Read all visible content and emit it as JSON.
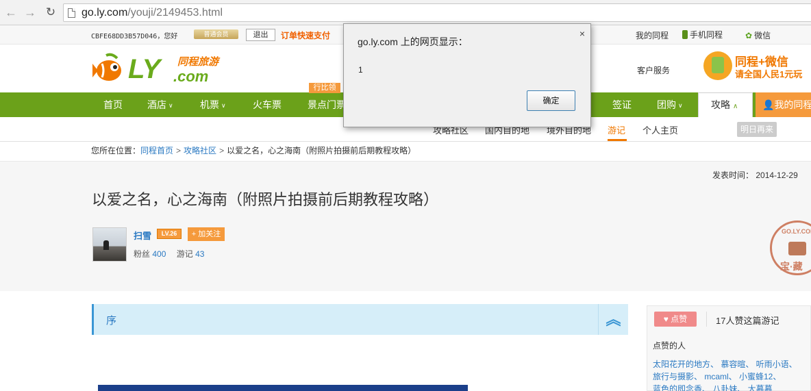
{
  "browser": {
    "url_host": "go.ly.com",
    "url_path": "/youji/2149453.html"
  },
  "topbar": {
    "user_text": "CBFE68DD3B57D046，您好",
    "member_badge": "普通会员",
    "logout_label": "退出",
    "pay_link": "订单快速支付",
    "my_journey": "我的同程",
    "mobile_journey": "手机同程",
    "wechat": "微信"
  },
  "header": {
    "logo_ly": "LY",
    "logo_com": ".com",
    "logo_sub": "同程旅游",
    "service": "客户服务",
    "promo_line1": "同程+微信",
    "promo_line2": "请全国人民1元玩"
  },
  "nav": {
    "items": [
      "首页",
      "酒店",
      "机票",
      "火车票",
      "景点门票",
      "签证",
      "团购"
    ],
    "badge": "行比领",
    "active": "攻略",
    "my_journey": "我的同程"
  },
  "subnav": {
    "items": [
      "攻略社区",
      "国内目的地",
      "境外目的地",
      "游记",
      "个人主页"
    ],
    "tomorrow": "明日再来"
  },
  "breadcrumb": {
    "prefix": "您所在位置：",
    "home": "同程首页",
    "community": "攻略社区",
    "current": "以爱之名，心之海南（附照片拍摄前后期教程攻略）"
  },
  "article": {
    "published_label": "发表时间：",
    "published_date": "2014-12-29",
    "title": "以爱之名，心之海南（附照片拍摄前后期教程攻略）",
    "author": "扫雪",
    "level": "LV.26",
    "follow": "+ 加关注",
    "fans_label": "粉丝",
    "fans_count": "400",
    "notes_label": "游记",
    "notes_count": "43",
    "stamp_top": "GO.LY.COM",
    "stamp_bottom": "宝·藏"
  },
  "section": {
    "title": "序"
  },
  "likes": {
    "button": "点赞",
    "count_text": "17人赞这篇游记",
    "likers_label": "点赞的人",
    "likers_line1": "太阳花开的地方、  慕容暄、  听雨小语、",
    "likers_line2": "旅行与摄影、  mcaml、  小蜜蜂12、",
    "likers_line3": "蓝色的即念香、  八卦妹、  大慕慕"
  },
  "dialog": {
    "title": "go.ly.com 上的网页显示：",
    "message": "1",
    "ok": "确定",
    "close": "×"
  },
  "colors": {
    "brand_green": "#6ba11a",
    "brand_orange": "#f59a3c",
    "link_blue": "#2a79c2"
  }
}
